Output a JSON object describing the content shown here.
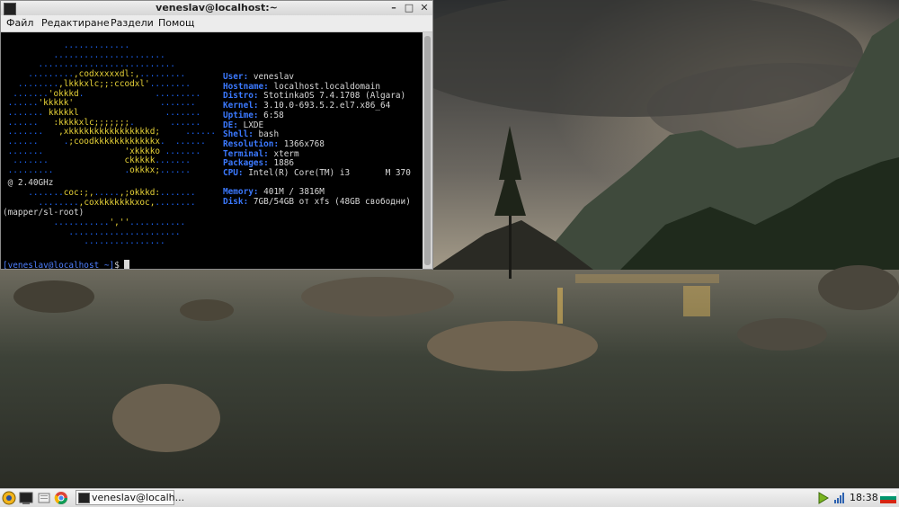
{
  "window": {
    "title": "veneslav@localhost:~",
    "menu": [
      "Файл",
      "Редактиране",
      "Раздели",
      "Помощ"
    ]
  },
  "terminal": {
    "logo_lines": [
      "            .............",
      "          ......................",
      "       ...........................",
      "     .........,codxxxxxdl:,.........",
      "   ........,lkkkxlc;;:ccodxl'........",
      "  .......'okkkd.              .........",
      " ......'kkkkk'                 .......",
      " ....... kkkkkl                 .......",
      " ......   :kkkkxlc;;;;;;;.       ......",
      " .......   ,xkkkkkkkkkkkkkkkkd;     ......",
      " ......     .;coodkkkkkkkkkkkkx.  ......",
      " .......                'xkkkko .......",
      "  .......               ckkkkk.......",
      " .........              .okkkx;......"
    ],
    "info": [
      {
        "key": "User:",
        "value": "veneslav"
      },
      {
        "key": "Hostname:",
        "value": "localhost.localdomain"
      },
      {
        "key": "Distro:",
        "value": "StotinkaOS 7.4.1708 (Algara)"
      },
      {
        "key": "Kernel:",
        "value": "3.10.0-693.5.2.el7.x86_64"
      },
      {
        "key": "Uptime:",
        "value": "6:58"
      },
      {
        "key": "DE:",
        "value": "LXDE"
      },
      {
        "key": "Shell:",
        "value": "bash"
      },
      {
        "key": "Resolution:",
        "value": "1366x768"
      },
      {
        "key": "Terminal:",
        "value": "xterm"
      },
      {
        "key": "Packages:",
        "value": "1886"
      },
      {
        "key": "CPU:",
        "value": "Intel(R) Core(TM) i3       M 370"
      },
      {
        "key": "Memory:",
        "value": "401M / 3816M"
      },
      {
        "key": "Disk:",
        "value": "7GB/54GB от xfs (48GB свободни)"
      }
    ],
    "cpu_wrap": " @ 2.40GHz",
    "logo_lines_after": [
      "     .......coc:;,.....,;okkkd:.......",
      "       ........,coxkkkkkkkxoc,........"
    ],
    "disk_wrap": "(mapper/sl-root)",
    "logo_tail": [
      "          ...........',''...........",
      "             ......................",
      "                ................"
    ],
    "prompt_user": "[veneslav@localhost ~]",
    "prompt_symbol": "$ "
  },
  "taskbar": {
    "task_label": "veneslav@localh...",
    "clock": "18:38"
  },
  "colors": {
    "logo_blue": "#1e68ff",
    "logo_yellow": "#e8d338",
    "info_key": "#3b79ff"
  }
}
